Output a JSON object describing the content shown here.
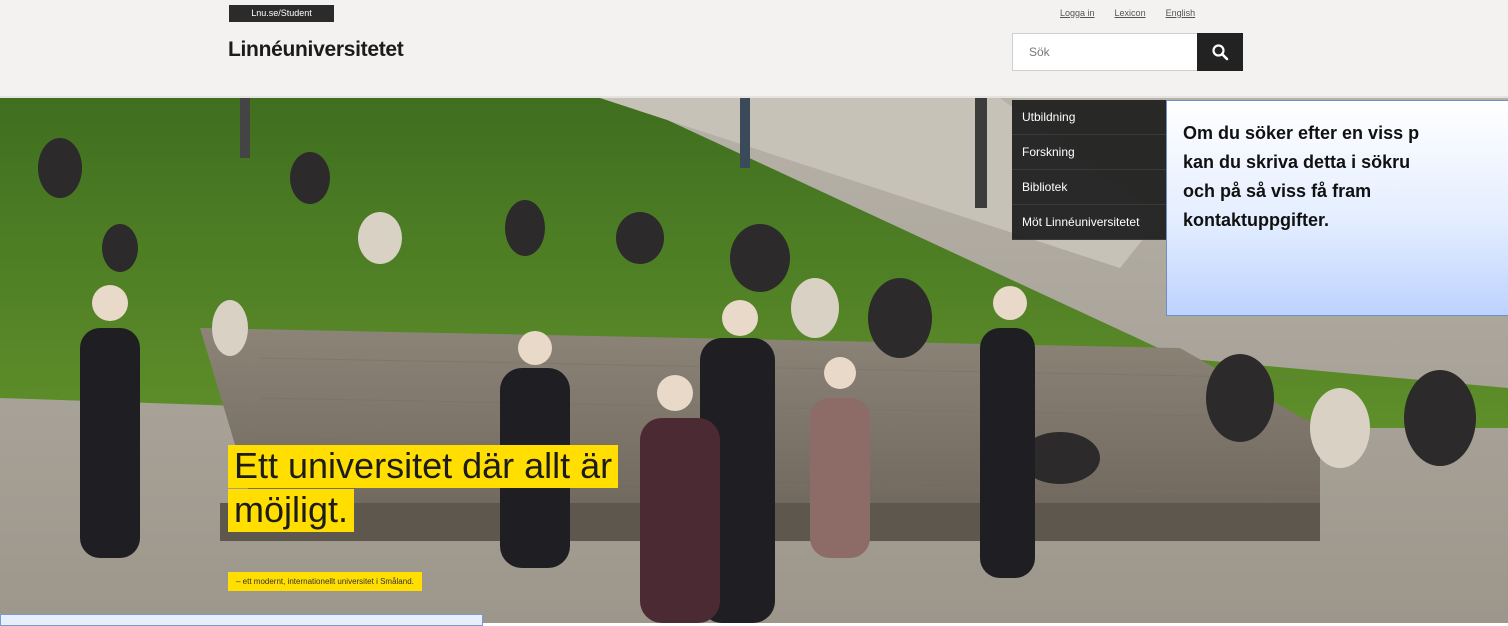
{
  "header": {
    "student_tab": "Lnu.se/Student",
    "logo_text": "Linnéuniversitetet",
    "links": [
      "Logga in",
      "Lexicon",
      "English"
    ],
    "search_placeholder": "Sök",
    "search_icon": "magnifier-icon"
  },
  "nav": {
    "items": [
      "Utbildning",
      "Forskning",
      "Bibliotek",
      "Möt Linnéuniversitetet"
    ]
  },
  "callout": {
    "lines": [
      "Om du söker efter en viss p",
      "kan du skriva detta i sökru",
      "och på så viss få fram",
      "kontaktuppgifter."
    ]
  },
  "hero": {
    "headline_line1": "Ett universitet där allt är",
    "headline_line2": "möjligt.",
    "tagline": "– ett modernt, internationellt universitet i Småland."
  },
  "colors": {
    "accent_yellow": "#ffde00",
    "nav_bg": "#1c1c1c",
    "callout_border": "#6f8fc0"
  }
}
